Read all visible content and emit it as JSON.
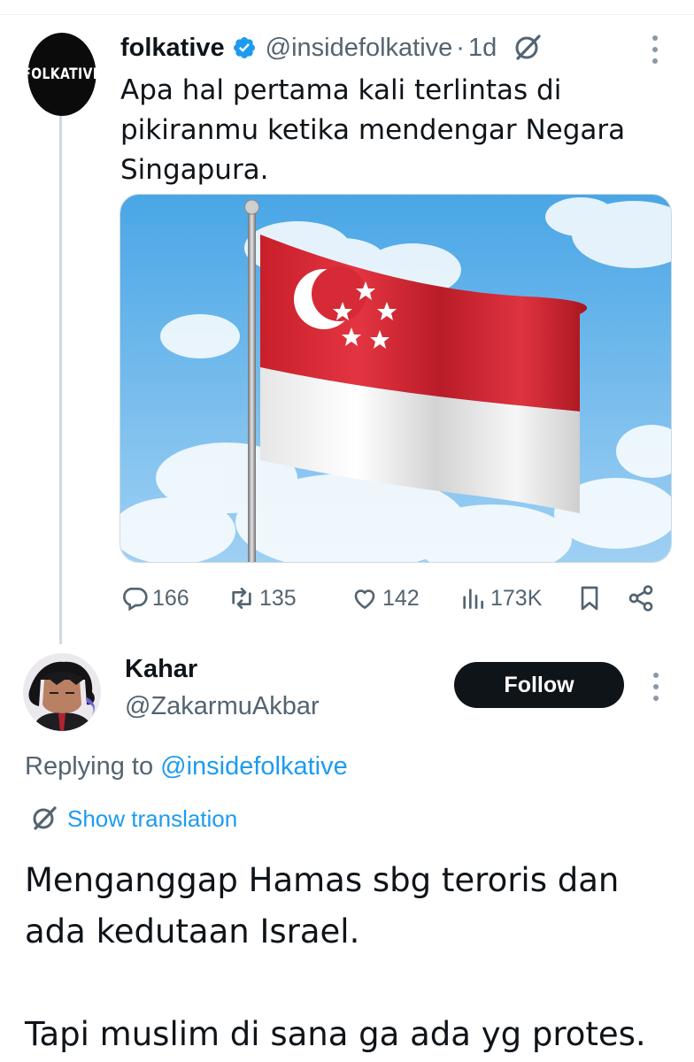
{
  "original_tweet": {
    "avatar_text": "FOLKATIVE",
    "author_name": "folkative",
    "verified_icon": "verified-badge-icon",
    "handle": "@insidefolkative",
    "separator": "·",
    "time": "1d",
    "text": "Apa hal pertama kali terlintas di pikiranmu ketika mendengar Negara Singapura.",
    "media": {
      "subject": "singapore-flag-photo"
    },
    "stats": {
      "replies": "166",
      "reposts": "135",
      "likes": "142",
      "views": "173K"
    }
  },
  "reply": {
    "author_name": "Kahar",
    "handle": "@ZakarmuAkbar",
    "follow_label": "Follow",
    "replying_prefix": "Replying to ",
    "replying_to": "@insidefolkative",
    "translation_label": "Show translation",
    "text_lines": [
      "Menganggap Hamas sbg teroris dan ada kedutaan Israel.",
      "Tapi muslim di sana ga ada yg protes."
    ]
  },
  "colors": {
    "text_primary": "#0f1419",
    "text_secondary": "#536471",
    "link": "#1d9bf0",
    "verified": "#1d9bf0",
    "follow_bg": "#0f1419",
    "flag_red": "#d62b36"
  }
}
